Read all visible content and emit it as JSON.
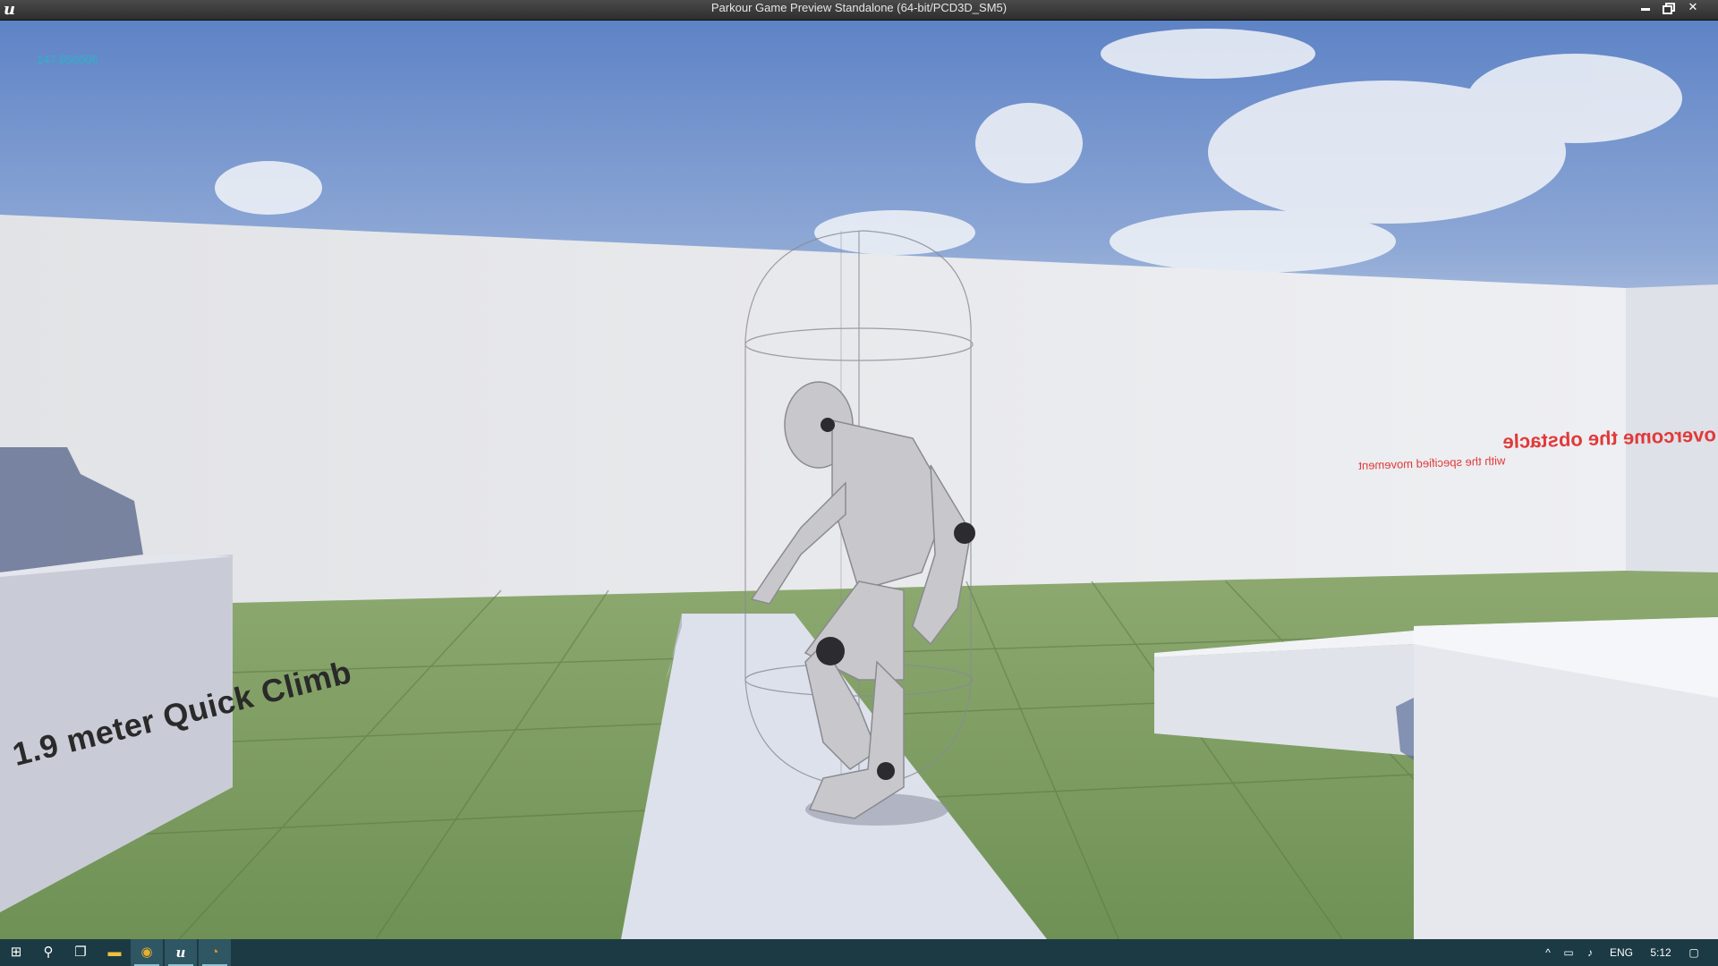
{
  "window": {
    "title": "Parkour Game Preview Standalone (64-bit/PCD3D_SM5)",
    "logo_glyph": "u",
    "minimize_icon": "minimize-icon",
    "restore_icon": "restore-icon",
    "close_glyph": "✕"
  },
  "hud": {
    "debug_value": "147.850006"
  },
  "scene": {
    "sign_text": "1.9 meter Quick Climb",
    "wall_message_large": "overcome the obstacle",
    "wall_message_small": "with the specified movement"
  },
  "taskbar": {
    "apps": [
      {
        "name": "Start",
        "icon": "windows-start-icon",
        "glyph": "⊞"
      },
      {
        "name": "Search",
        "icon": "search-icon",
        "glyph": "⚲"
      },
      {
        "name": "Task View",
        "icon": "task-view-icon",
        "glyph": "❐"
      },
      {
        "name": "File Explorer",
        "icon": "folder-icon",
        "glyph": "▬"
      },
      {
        "name": "Google Chrome",
        "icon": "chrome-icon",
        "glyph": "◉"
      },
      {
        "name": "Unreal Engine",
        "icon": "unreal-icon",
        "glyph": "u"
      },
      {
        "name": "Blender",
        "icon": "blender-icon",
        "glyph": "◔"
      }
    ],
    "tray": {
      "chevron_glyph": "^",
      "network_glyph": "▭",
      "volume_glyph": "♪",
      "language": "ENG",
      "time": "5:12",
      "notification_glyph": "▢"
    }
  },
  "colors": {
    "debug_text": "#2bb3c9",
    "wall_message": "#e03a3a",
    "taskbar": "#1b3a44"
  }
}
